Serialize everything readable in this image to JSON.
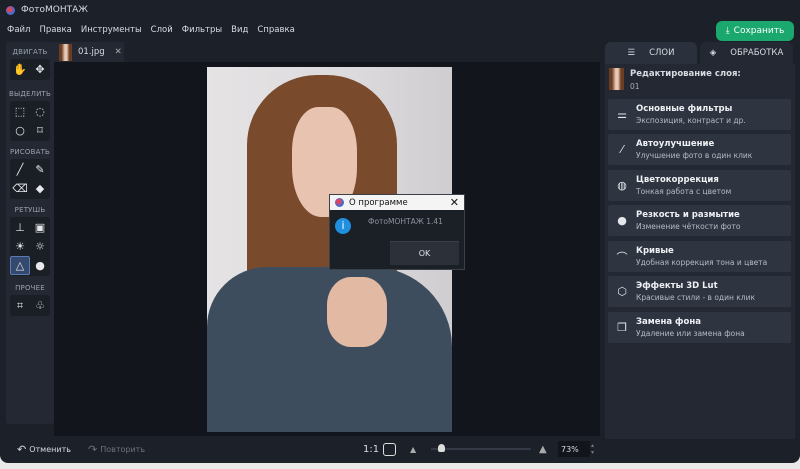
{
  "app": {
    "title": "ФотоМОНТАЖ",
    "save_label": "Сохранить"
  },
  "menu": [
    "Файл",
    "Правка",
    "Инструменты",
    "Слой",
    "Фильтры",
    "Вид",
    "Справка"
  ],
  "tools": {
    "groups": [
      {
        "label": "ДВИГАТЬ",
        "items": [
          "hand",
          "move"
        ]
      },
      {
        "label": "ВЫДЕЛИТЬ",
        "items": [
          "rect-select",
          "ellipse-select",
          "lasso",
          "polygon-lasso"
        ]
      },
      {
        "label": "РИСОВАТЬ",
        "items": [
          "brush",
          "pencil",
          "eraser",
          "fill"
        ]
      },
      {
        "label": "РЕТУШЬ",
        "items": [
          "stamp",
          "patch",
          "brighten",
          "darken",
          "sharpen",
          "blur"
        ]
      },
      {
        "label": "ПРОЧЕЕ",
        "items": [
          "crop",
          "shapes"
        ]
      }
    ]
  },
  "document_tab": {
    "name": "01.jpg"
  },
  "dialog": {
    "title": "О программе",
    "text": "ФотоМОНТАЖ 1.41",
    "ok": "OK"
  },
  "panel": {
    "tab_layers": "СЛОИ",
    "tab_processing": "ОБРАБОТКА",
    "editing_label": "Редактирование слоя:",
    "layer_name": "01",
    "cards": [
      {
        "title": "Основные фильтры",
        "subtitle": "Экспозиция, контраст и др.",
        "icon": "sliders"
      },
      {
        "title": "Автоулучшение",
        "subtitle": "Улучшение фото в один клик",
        "icon": "magic-wand"
      },
      {
        "title": "Цветокоррекция",
        "subtitle": "Тонкая работа с цветом",
        "icon": "palette"
      },
      {
        "title": "Резкость и размытие",
        "subtitle": "Изменение чёткости фото",
        "icon": "drop"
      },
      {
        "title": "Кривые",
        "subtitle": "Удобная коррекция тона и цвета",
        "icon": "curve"
      },
      {
        "title": "Эффекты 3D Lut",
        "subtitle": "Красивые стили - в один клик",
        "icon": "cube"
      },
      {
        "title": "Замена фона",
        "subtitle": "Удаление или замена фона",
        "icon": "layers"
      }
    ]
  },
  "bottom": {
    "undo": "Отменить",
    "redo": "Повторить",
    "ratio": "1:1",
    "zoom": "73%",
    "zoom_value": 0.1
  },
  "colors": {
    "accent": "#1aa86f",
    "active_tool": "#35496e"
  }
}
